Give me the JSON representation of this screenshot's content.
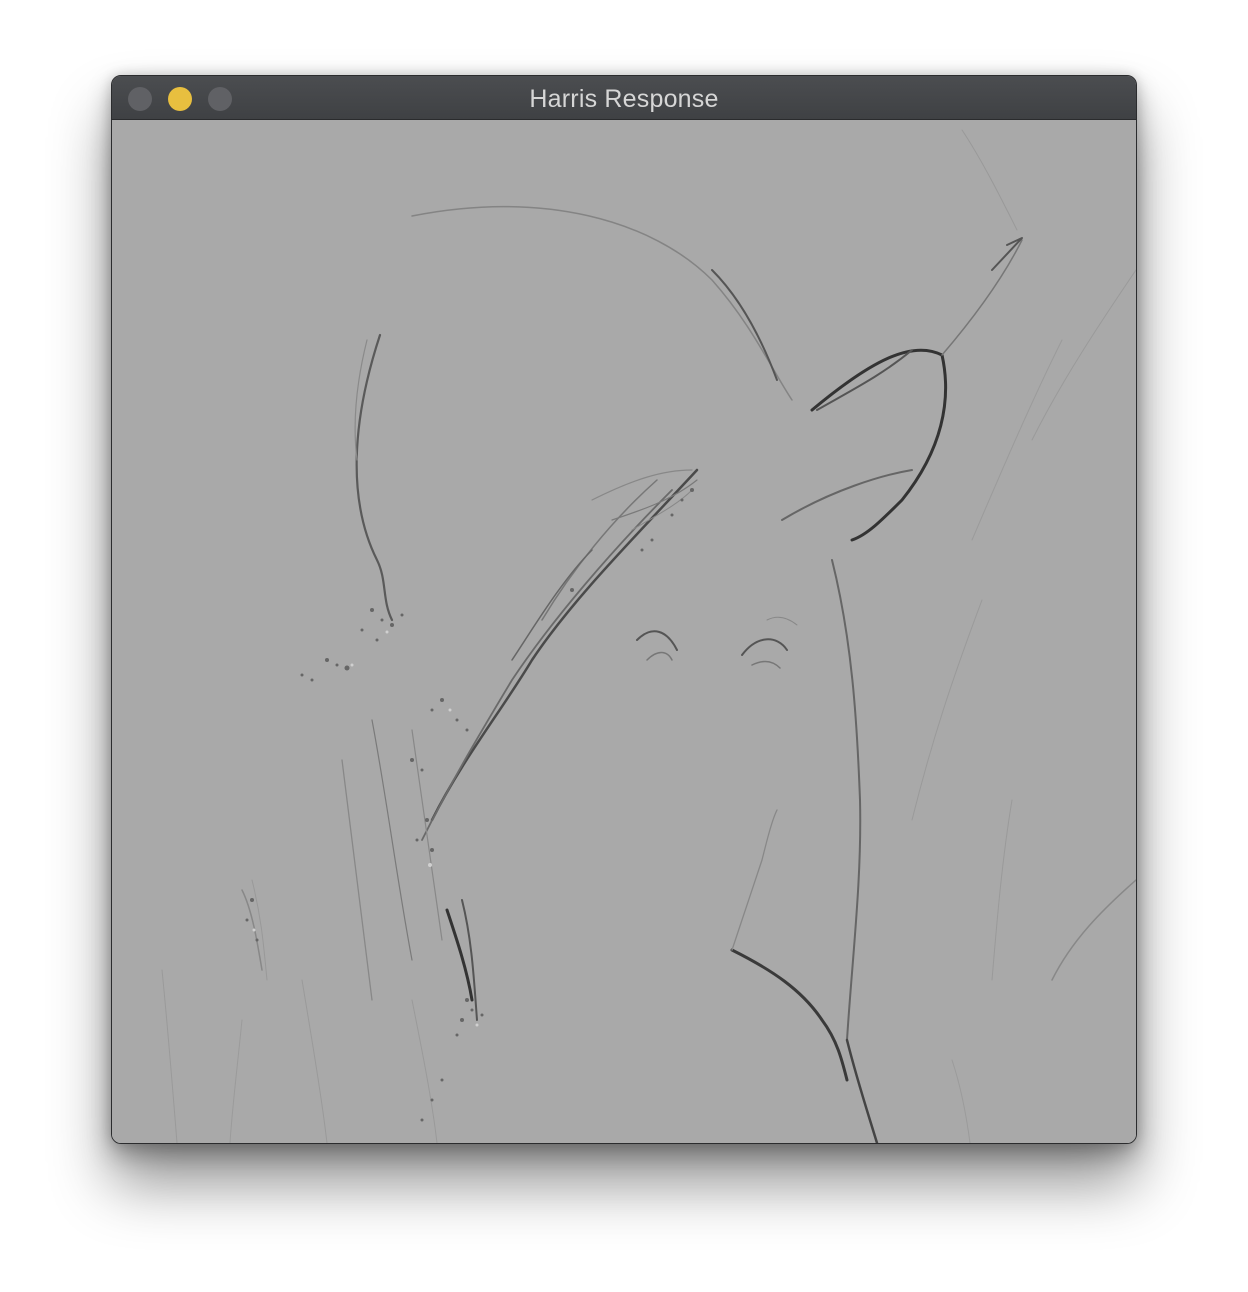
{
  "window": {
    "title": "Harris Response",
    "controls": {
      "close": "close-button",
      "minimize": "minimize-button",
      "maximize": "zoom-button"
    }
  },
  "image": {
    "description_type": "grayscale edge/corner response map",
    "background_color": "#a9a9a9",
    "edge_color": "#555555"
  }
}
